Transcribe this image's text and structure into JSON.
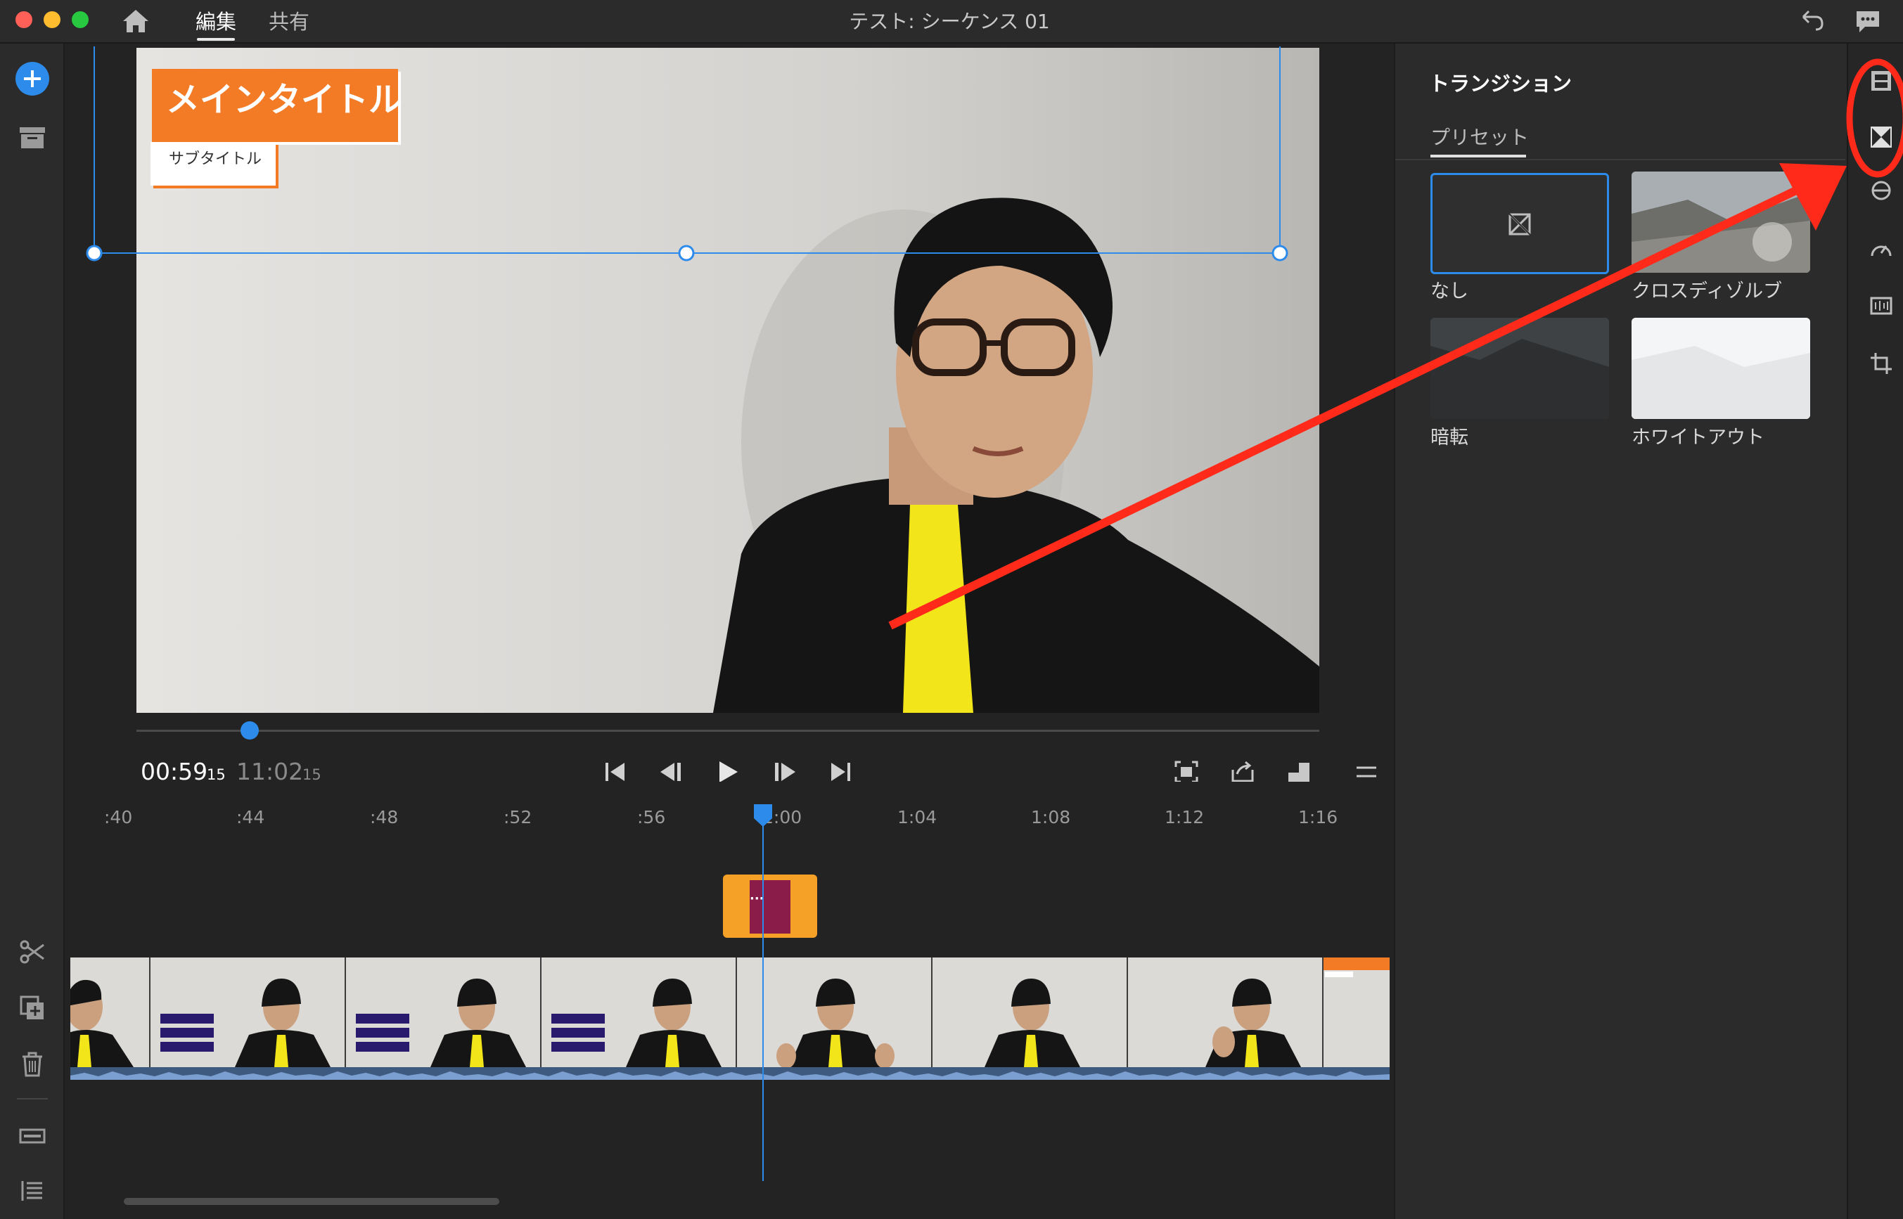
{
  "window": {
    "title": "テスト: シーケンス 01",
    "tabs": [
      {
        "label": "編集",
        "active": true
      },
      {
        "label": "共有",
        "active": false
      }
    ]
  },
  "monitor": {
    "title_graphic": {
      "main": "メインタイトル",
      "sub": "サブタイトル"
    },
    "current_time": "00:59",
    "current_frames": "15",
    "total_time": "11:02",
    "total_frames": "15"
  },
  "timeline": {
    "ruler_labels": [
      ":40",
      ":44",
      ":48",
      ":52",
      ":56",
      "1:00",
      "1:04",
      "1:08",
      "1:12",
      "1:16"
    ],
    "clip_thumbnail_count": 8
  },
  "panel": {
    "title": "トランジション",
    "tab": "プリセット",
    "presets": [
      {
        "label": "なし",
        "selected": true
      },
      {
        "label": "クロスディゾルブ",
        "selected": false
      },
      {
        "label": "暗転",
        "selected": false
      },
      {
        "label": "ホワイトアウト",
        "selected": false
      }
    ]
  },
  "colors": {
    "accent": "#2d8ceb",
    "title_orange": "#f47b26",
    "annotation_red": "#ff2a1a"
  },
  "icons": {
    "left_toolbar": [
      "add-media-icon",
      "archive-icon",
      "scissors-icon",
      "duplicate-icon",
      "trash-icon",
      "track-icon",
      "list-icon"
    ],
    "right_rail": [
      "filmstrip-icon",
      "transition-icon",
      "color-icon",
      "speed-icon",
      "audio-icon",
      "crop-icon"
    ]
  }
}
